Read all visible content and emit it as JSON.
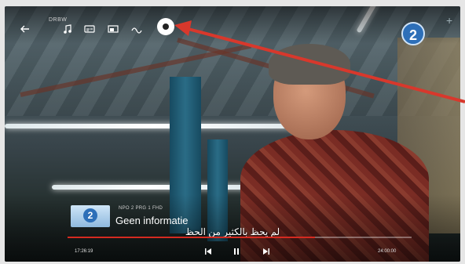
{
  "top_bar": {
    "icons": [
      "back-arrow-icon",
      "music-note-icon",
      "subtitles-icon",
      "picture-in-picture-icon",
      "wave-icon",
      "info-icon"
    ],
    "small_label": "DRBW"
  },
  "channel_logo": {
    "text": "2",
    "color": "#2d6fb8"
  },
  "plus_icon": "+",
  "overlay": {
    "program_title": "NPO 2 PRG 1 FHD",
    "program_info": "Geen informatie",
    "subtitle_text": "لم يحظ بالكثير من الحظ",
    "channel_thumb": "2"
  },
  "player": {
    "time_start": "17:26:19",
    "time_end": "24:00:00",
    "progress": 0.72,
    "progress_color": "#d42a20"
  },
  "annotation_arrow_color": "#d8382c"
}
